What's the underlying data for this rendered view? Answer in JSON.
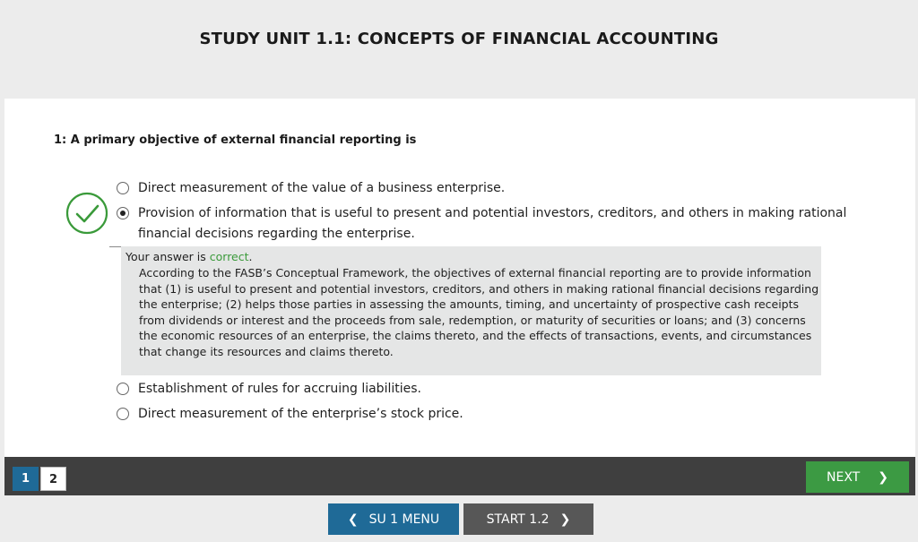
{
  "header": {
    "title": "STUDY UNIT 1.1: CONCEPTS OF FINANCIAL ACCOUNTING"
  },
  "question": {
    "text": "1: A primary objective of external financial reporting is"
  },
  "options": [
    {
      "text": "Direct measurement of the value of a business enterprise.",
      "selected": false
    },
    {
      "text": "Provision of information that is useful to present and potential investors, creditors, and others in making rational financial decisions regarding the enterprise.",
      "selected": true
    },
    {
      "text": "Establishment of rules for accruing liabilities.",
      "selected": false
    },
    {
      "text": "Direct measurement of the enterprise’s stock price.",
      "selected": false
    }
  ],
  "feedback": {
    "prefix": "Your answer is ",
    "result": "correct",
    "suffix": ".",
    "explanation": "According to the FASB’s Conceptual Framework, the objectives of external financial reporting are to provide information that (1) is useful to present and potential investors, creditors, and others in making rational financial decisions regarding the enterprise; (2) helps those parties in assessing the amounts, timing, and uncertainty of prospective cash receipts from dividends or interest and the proceeds from sale, redemption, or maturity of securities or loans; and (3) concerns the economic resources of an enterprise, the claims thereto, and the effects of transactions, events, and circumstances that change its resources and claims thereto."
  },
  "pagination": {
    "pages": [
      "1",
      "2"
    ],
    "current": "1"
  },
  "nav": {
    "next_label": "NEXT",
    "menu_label": "SU 1 MENU",
    "start_label": "START 1.2"
  },
  "colors": {
    "correct": "#3a9a3a",
    "primary": "#1f6a97",
    "next": "#3c9a43",
    "navbar": "#3f3f3f"
  },
  "icons": {
    "check": "check-circle-icon",
    "left": "chevron-left-icon",
    "right": "chevron-right-icon"
  }
}
